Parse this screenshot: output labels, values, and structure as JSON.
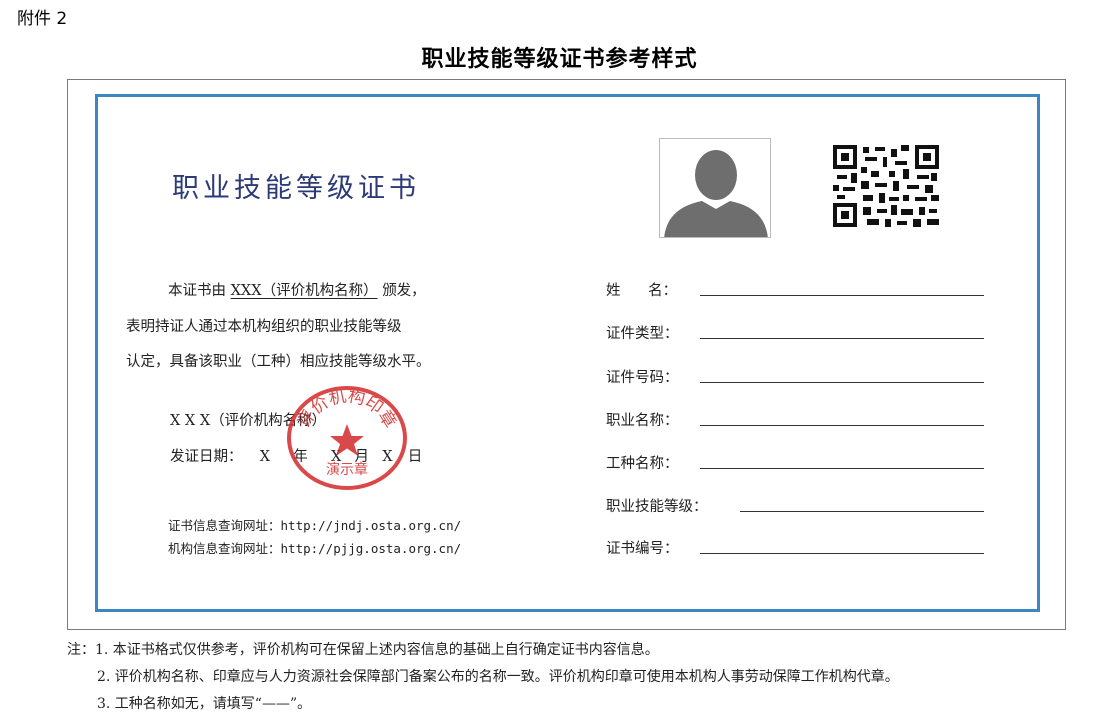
{
  "attachment_label": "附件 2",
  "document_title": "职业技能等级证书参考样式",
  "certificate": {
    "title": "职业技能等级证书",
    "photo_placeholder": "person-silhouette-icon",
    "qr_icon": "qr-code-icon",
    "body": {
      "line1_prefix": "本证书由",
      "issuer": "XXX（评价机构名称）",
      "line1_suffix": "颁发，",
      "line2": "表明持证人通过本机构组织的职业技能等级",
      "line3": "认定，具备该职业（工种）相应技能等级水平。"
    },
    "signature_org": "X X X（评价机构名称）",
    "issue_date": {
      "label": "发证日期：",
      "year_mark": "X",
      "year_unit": "年",
      "month_mark": "X",
      "month_unit": "月",
      "day_mark": "X",
      "day_unit": "日"
    },
    "seal": {
      "text": "评价机构印章",
      "subtext": "演示章",
      "color": "#d42a2a"
    },
    "query_urls": [
      {
        "label": "证书信息查询网址：",
        "url": "http://jndj.osta.org.cn/"
      },
      {
        "label": "机构信息查询网址：",
        "url": "http://pjjg.osta.org.cn/"
      }
    ],
    "fields": [
      {
        "label": "姓      名："
      },
      {
        "label": "证件类型："
      },
      {
        "label": "证件号码："
      },
      {
        "label": "职业名称："
      },
      {
        "label": "工种名称："
      },
      {
        "label": "职业技能等级："
      },
      {
        "label": "证书编号："
      }
    ],
    "border_color": "#3c86c4",
    "title_color": "#2c3a78"
  },
  "notes": [
    "注：1. 本证书格式仅供参考，评价机构可在保留上述内容信息的基础上自行确定证书内容信息。",
    "2. 评价机构名称、印章应与人力资源社会保障部门备案公布的名称一致。评价机构印章可使用本机构人事劳动保障工作机构代章。",
    "3. 工种名称如无，请填写“——”。"
  ]
}
